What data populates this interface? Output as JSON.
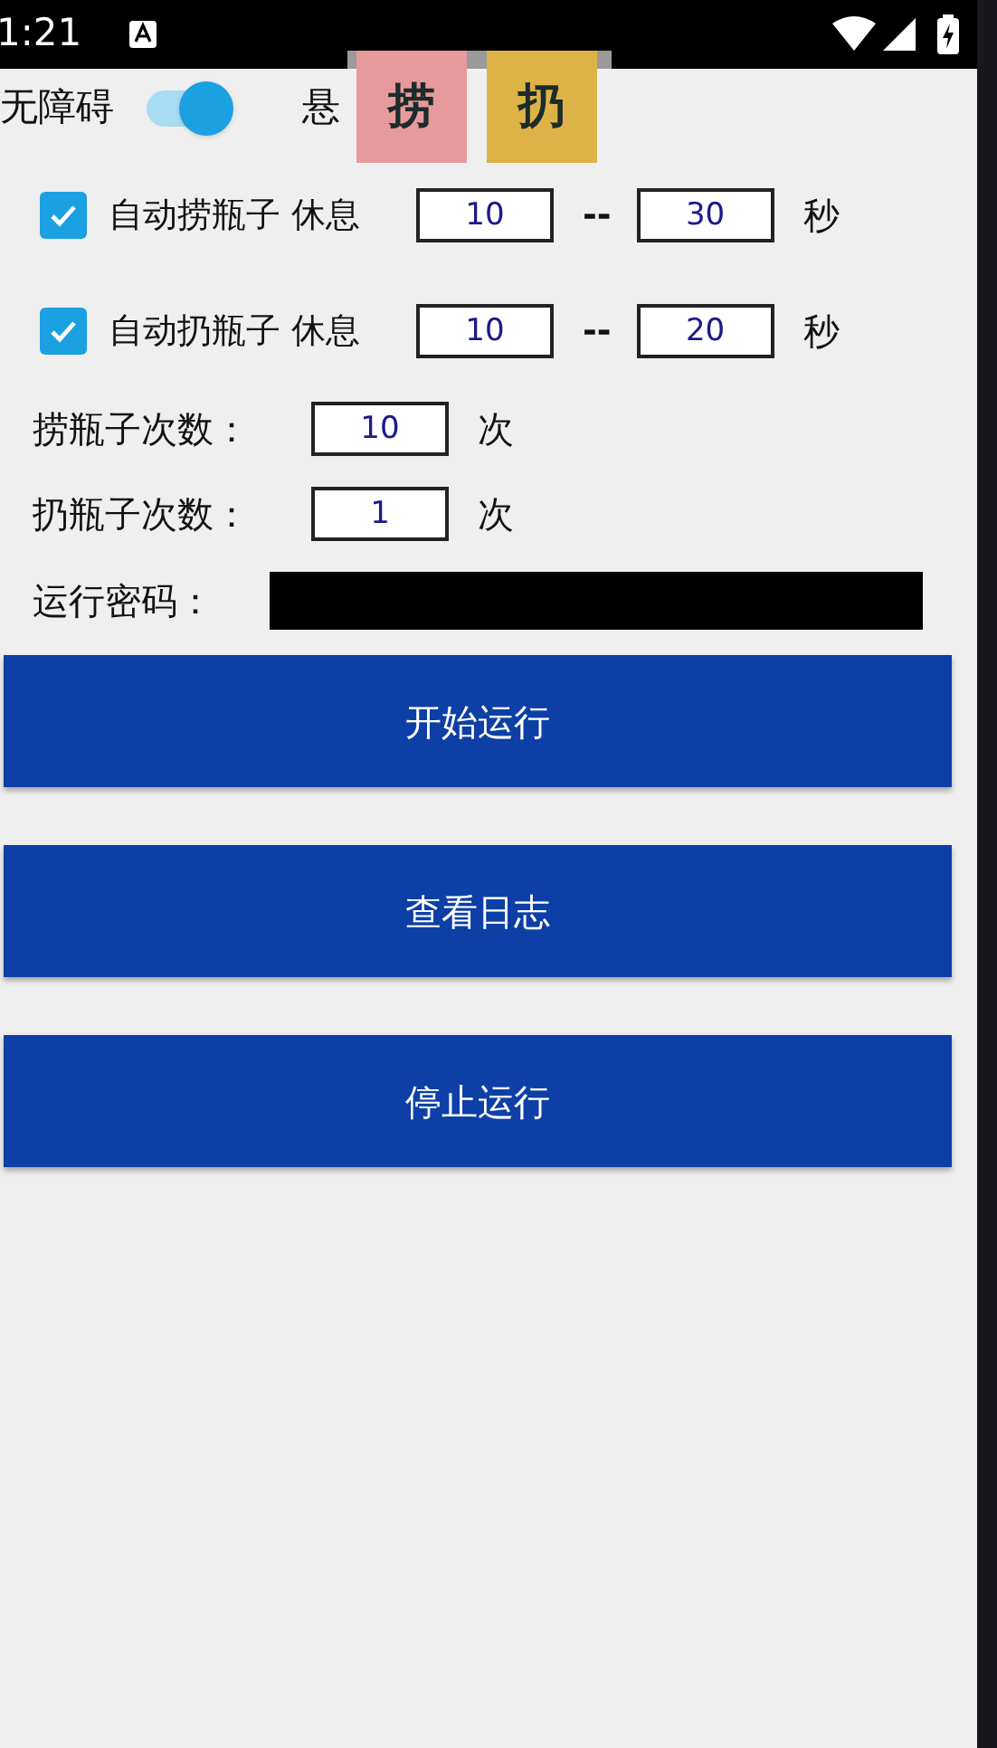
{
  "status_bar": {
    "time": "1:21"
  },
  "accessibility": {
    "label": "无障碍",
    "on": true
  },
  "floating_window": {
    "label": "悬"
  },
  "floating_buttons": [
    {
      "label": "捞",
      "color": "#e79a9c"
    },
    {
      "label": "扔",
      "color": "#ddb347"
    }
  ],
  "auto_rows": [
    {
      "label": "自动捞瓶子 休息",
      "checked": true,
      "min": "10",
      "separator": "--",
      "max": "30",
      "unit": "秒"
    },
    {
      "label": "自动扔瓶子 休息",
      "checked": true,
      "min": "10",
      "separator": "--",
      "max": "20",
      "unit": "秒"
    }
  ],
  "count_rows": [
    {
      "label": "捞瓶子次数：",
      "value": "10",
      "unit": "次"
    },
    {
      "label": "扔瓶子次数：",
      "value": "1",
      "unit": "次"
    }
  ],
  "password": {
    "label": "运行密码："
  },
  "buttons": [
    "开始运行",
    "查看日志",
    "停止运行"
  ]
}
